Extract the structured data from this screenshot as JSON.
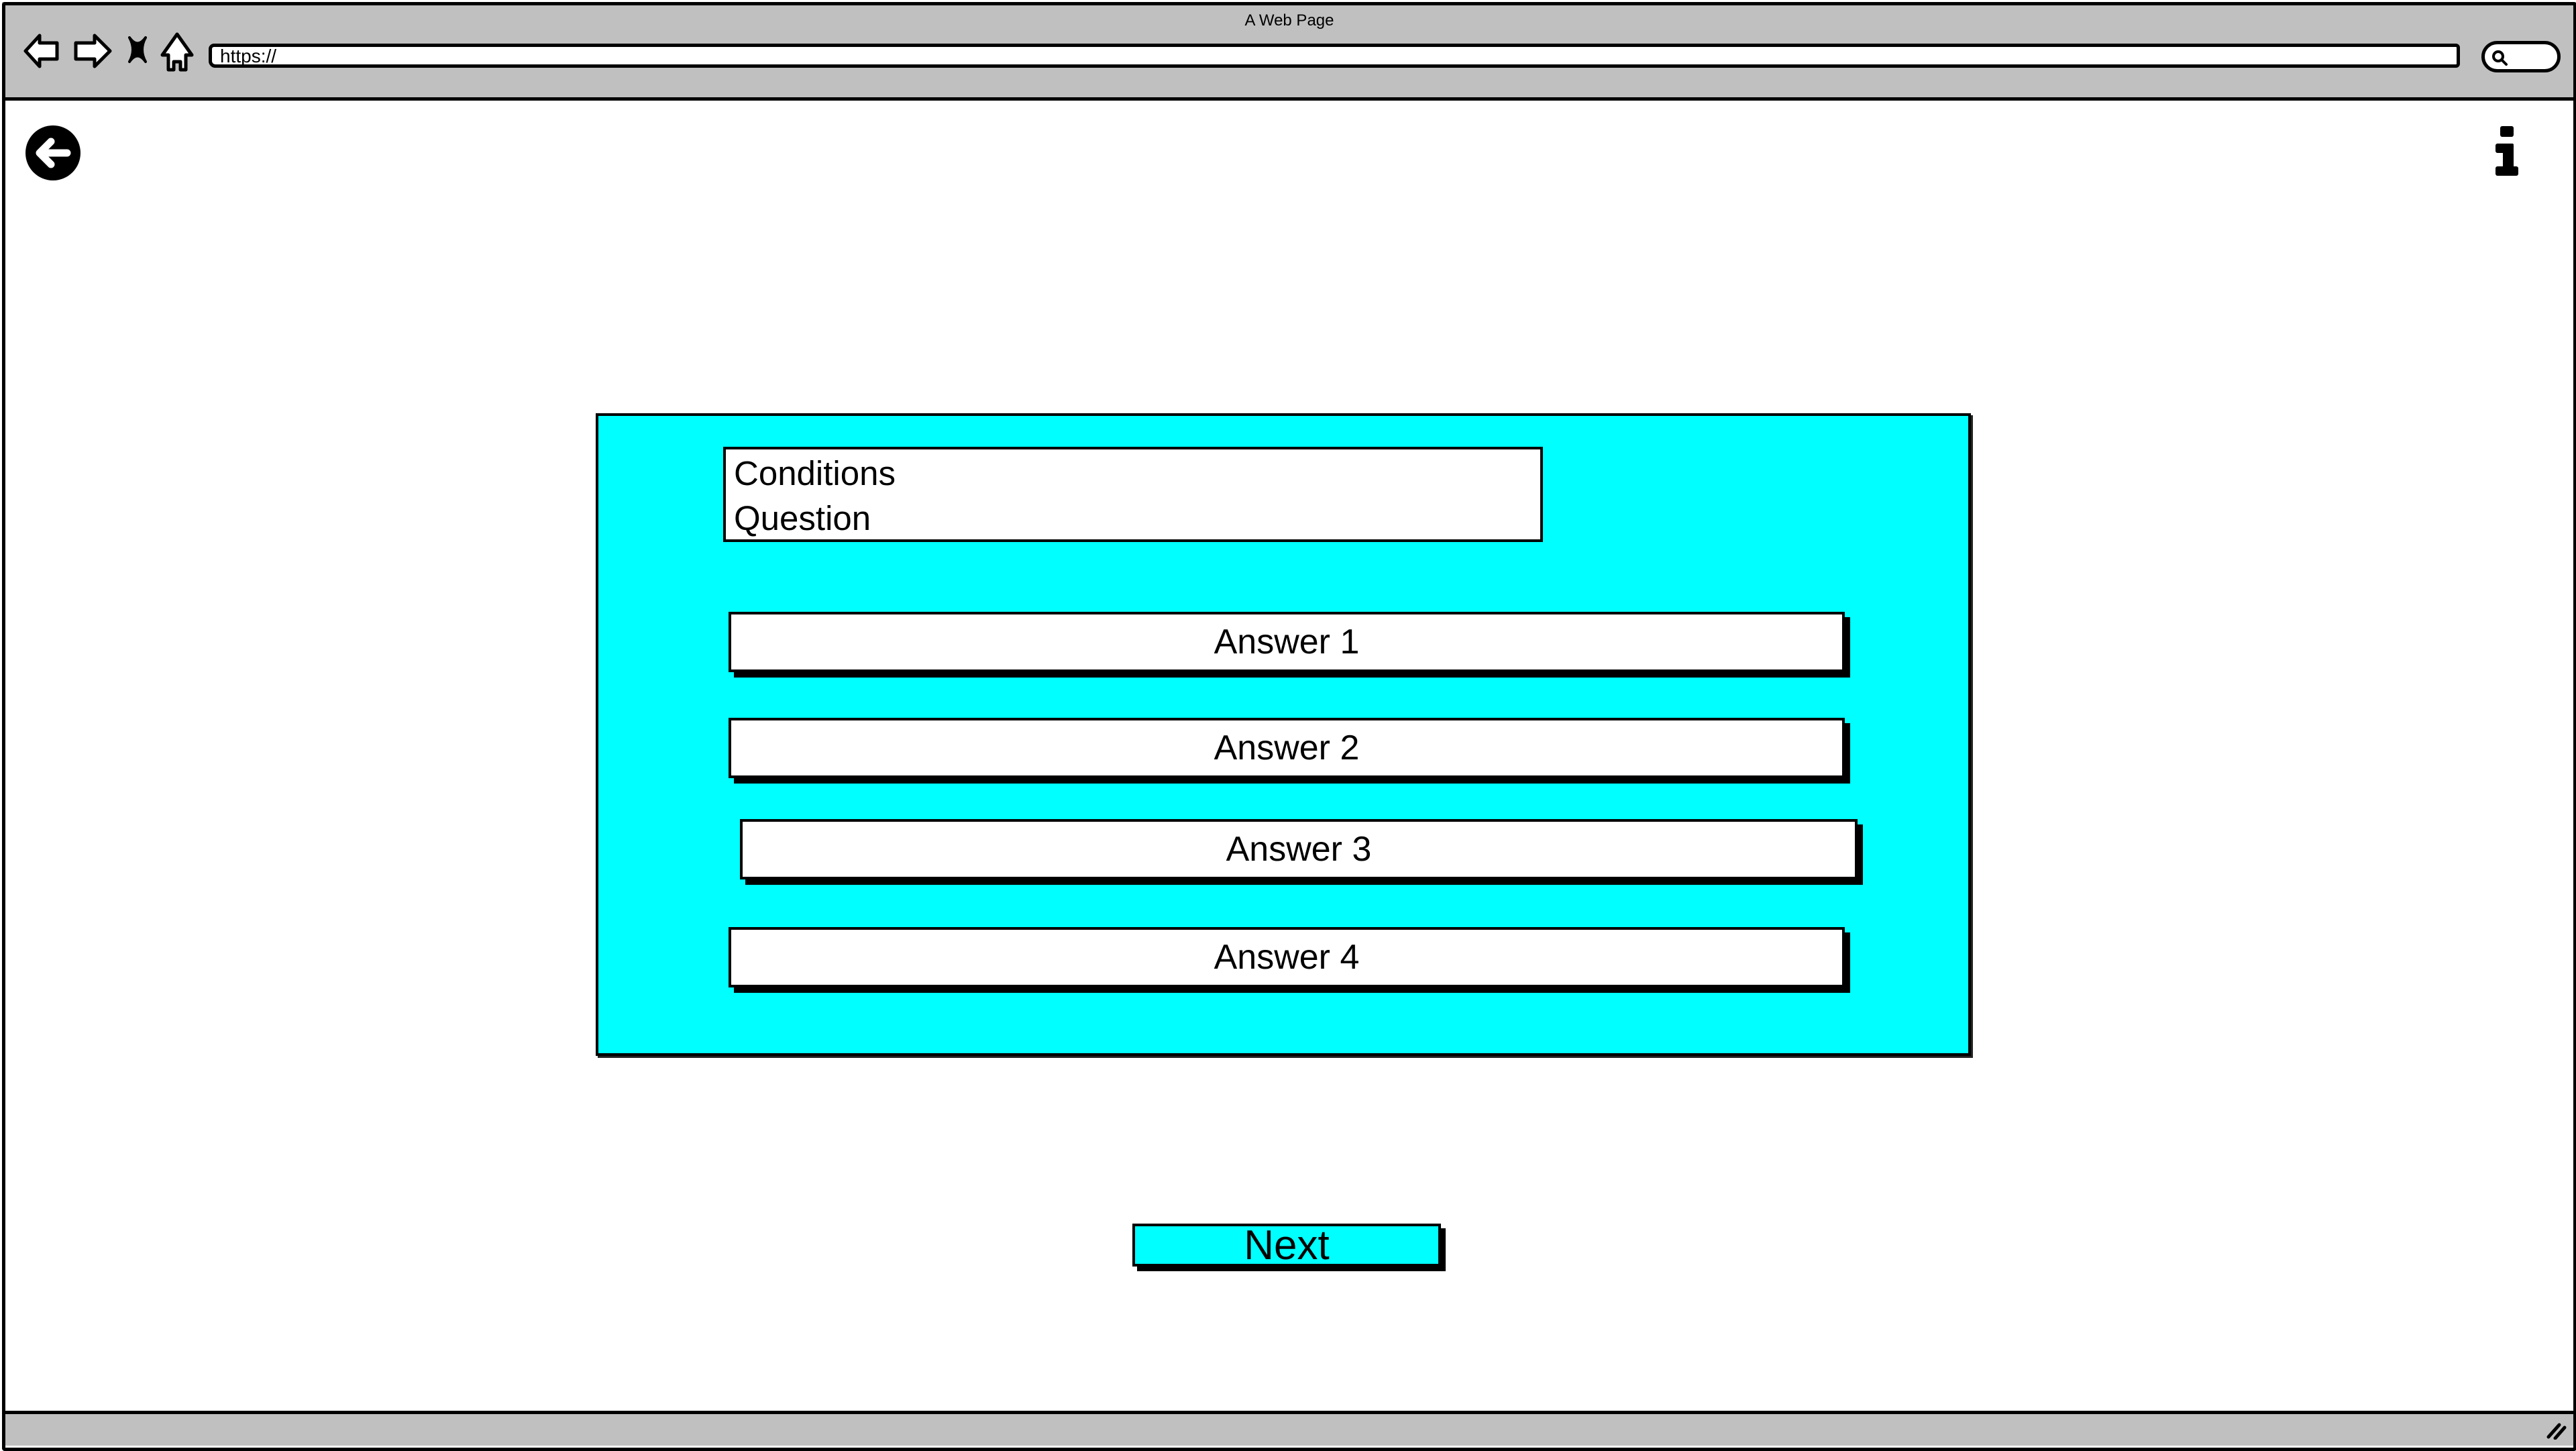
{
  "browser": {
    "window_title": "A Web Page",
    "url": "https://",
    "nav_icons": [
      "back-arrow-icon",
      "forward-arrow-icon",
      "stop-icon",
      "home-icon"
    ],
    "search_icon": "search-icon"
  },
  "page": {
    "back_icon": "circle-arrow-left-icon",
    "info_icon": "info-icon",
    "question": {
      "lines": [
        "Conditions",
        "Question"
      ]
    },
    "answers": [
      {
        "label": "Answer 1"
      },
      {
        "label": "Answer 2"
      },
      {
        "label": "Answer 3"
      },
      {
        "label": "Answer 4"
      }
    ],
    "next_label": "Next"
  },
  "colors": {
    "accent": "#00ffff",
    "chrome": "#c0c0c0",
    "surface": "#ffffff",
    "ink": "#000000"
  }
}
